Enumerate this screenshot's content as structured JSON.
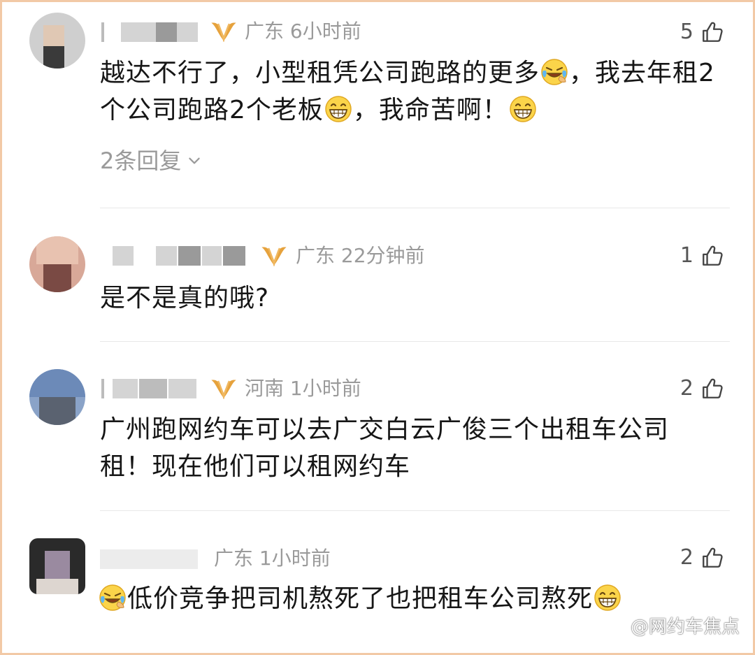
{
  "colors": {
    "meta_gray": "#9a9a9a",
    "text": "#161616",
    "divider": "#e8e8e8",
    "vip_gold": "#e6a23c"
  },
  "comments": [
    {
      "location": "广东",
      "time": "6小时前",
      "likes": "5",
      "text_parts": [
        "越达不行了，小型租凭公司跑路的更多",
        "，我去年租2个公司跑路2个老板",
        "，我命苦啊！"
      ],
      "replies": "2条回复"
    },
    {
      "location": "广东",
      "time": "22分钟前",
      "likes": "1",
      "text": "是不是真的哦?"
    },
    {
      "location": "河南",
      "time": "1小时前",
      "likes": "2",
      "text_line1": "广州跑网约车可以去广交白云广俊三个出租车公司",
      "text_line2": "租！现在他们可以租网约车"
    },
    {
      "location": "广东",
      "time": "1小时前",
      "likes": "2",
      "text": "低价竞争把司机熬死了也把租车公司熬死"
    }
  ],
  "watermark": "@网约车焦点",
  "icons": [
    "thumbs-up-icon",
    "vip-badge-icon",
    "chevron-down-icon",
    "laughing-crying-emoji",
    "grinning-emoji",
    "weibo-logo-icon"
  ]
}
